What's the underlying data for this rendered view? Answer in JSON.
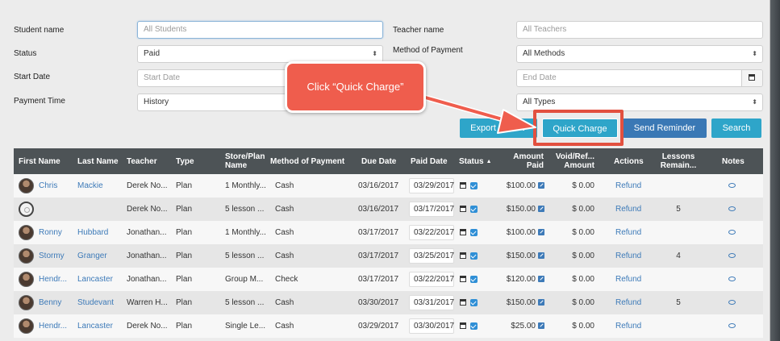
{
  "filters": {
    "student_name_label": "Student name",
    "student_name_value": "All Students",
    "status_label": "Status",
    "status_value": "Paid",
    "start_date_label": "Start Date",
    "start_date_placeholder": "Start Date",
    "payment_time_label": "Payment Time",
    "payment_time_value": "History",
    "teacher_name_label": "Teacher name",
    "teacher_name_value": "All Teachers",
    "method_label": "Method of Payment",
    "method_value": "All Methods",
    "end_date_placeholder": "End Date",
    "type_value": "All Types"
  },
  "buttons": {
    "export_csv": "Export to CSV",
    "quick_charge": "Quick Charge",
    "send_reminder": "Send Reminder",
    "search": "Search"
  },
  "callout": {
    "text": "Click “Quick Charge”"
  },
  "table": {
    "headers": {
      "first_name": "First Name",
      "last_name": "Last Name",
      "teacher": "Teacher",
      "type": "Type",
      "store_plan": "Store/Plan Name",
      "method": "Method of Payment",
      "due_date": "Due Date",
      "paid_date": "Paid Date",
      "status": "Status",
      "amount_paid": "Amount Paid",
      "void_refund": "Void/Ref... Amount",
      "actions": "Actions",
      "lessons": "Lessons Remain...",
      "notes": "Notes"
    },
    "rows": [
      {
        "first": "Chris",
        "last": "Mackie",
        "teacher": "Derek No...",
        "type": "Plan",
        "plan": "1 Monthly...",
        "method": "Cash",
        "due": "03/16/2017",
        "paid": "03/29/2017",
        "amount": "$100.00",
        "void": "$ 0.00",
        "action": "Refund",
        "lessons": ""
      },
      {
        "first": "",
        "last": "",
        "teacher": "Derek No...",
        "type": "Plan",
        "plan": "5 lesson ...",
        "method": "Cash",
        "due": "03/16/2017",
        "paid": "03/17/2017",
        "amount": "$150.00",
        "void": "$ 0.00",
        "action": "Refund",
        "lessons": "5"
      },
      {
        "first": "Ronny",
        "last": "Hubbard",
        "teacher": "Jonathan...",
        "type": "Plan",
        "plan": "1 Monthly...",
        "method": "Cash",
        "due": "03/17/2017",
        "paid": "03/22/2017",
        "amount": "$100.00",
        "void": "$ 0.00",
        "action": "Refund",
        "lessons": ""
      },
      {
        "first": "Stormy",
        "last": "Granger",
        "teacher": "Jonathan...",
        "type": "Plan",
        "plan": "5 lesson ...",
        "method": "Cash",
        "due": "03/17/2017",
        "paid": "03/25/2017",
        "amount": "$150.00",
        "void": "$ 0.00",
        "action": "Refund",
        "lessons": "4"
      },
      {
        "first": "Hendr...",
        "last": "Lancaster",
        "teacher": "Jonathan...",
        "type": "Plan",
        "plan": "Group M...",
        "method": "Check",
        "due": "03/17/2017",
        "paid": "03/22/2017",
        "amount": "$120.00",
        "void": "$ 0.00",
        "action": "Refund",
        "lessons": ""
      },
      {
        "first": "Benny",
        "last": "Studevant",
        "teacher": "Warren H...",
        "type": "Plan",
        "plan": "5 lesson ...",
        "method": "Cash",
        "due": "03/30/2017",
        "paid": "03/31/2017",
        "amount": "$150.00",
        "void": "$ 0.00",
        "action": "Refund",
        "lessons": "5"
      },
      {
        "first": "Hendr...",
        "last": "Lancaster",
        "teacher": "Derek No...",
        "type": "Plan",
        "plan": "Single Le...",
        "method": "Cash",
        "due": "03/29/2017",
        "paid": "03/30/2017",
        "amount": "$25.00",
        "void": "$ 0.00",
        "action": "Refund",
        "lessons": ""
      }
    ]
  },
  "colors": {
    "accent_teal": "#2ea5c9",
    "accent_blue": "#3a78b5",
    "callout_red": "#ef5d4d",
    "header_dark": "#4d5356"
  }
}
